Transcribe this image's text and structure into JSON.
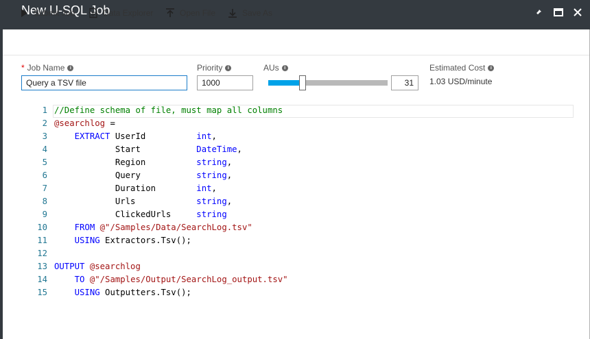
{
  "window": {
    "title": "New U-SQL Job"
  },
  "toolbar": {
    "submit_label": "Submit Job",
    "explorer_label": "Data Explorer",
    "open_label": "Open File",
    "saveas_label": "Save As"
  },
  "form": {
    "job_name_label": "Job Name",
    "required_mark": "*",
    "job_name_value": "Query a TSV file",
    "priority_label": "Priority",
    "priority_value": "1000",
    "aus_label": "AUs",
    "aus_value": "31",
    "aus_slider_fraction": 0.27,
    "cost_label": "Estimated Cost",
    "cost_value": "1.03 USD/minute",
    "info_glyph": "i"
  },
  "colors": {
    "titlebar": "#343a40",
    "accent": "#00a2e8",
    "keyword": "#0000ff",
    "string": "#a31515",
    "comment": "#008000",
    "line_number": "#237893"
  },
  "icons": [
    "pin-icon",
    "maximize-icon",
    "close-icon",
    "play-icon",
    "document-icon",
    "upload-icon",
    "download-icon",
    "info-icon"
  ],
  "editor": {
    "lines": [
      {
        "num": "1",
        "tokens": [
          {
            "t": "//Define schema of file, must map all columns",
            "c": "cm"
          }
        ]
      },
      {
        "num": "2",
        "tokens": [
          {
            "t": "@searchlog",
            "c": "str"
          },
          {
            "t": " =",
            "c": ""
          }
        ]
      },
      {
        "num": "3",
        "tokens": [
          {
            "t": "    ",
            "c": ""
          },
          {
            "t": "EXTRACT",
            "c": "kw"
          },
          {
            "t": " UserId          ",
            "c": ""
          },
          {
            "t": "int",
            "c": "kw"
          },
          {
            "t": ",",
            "c": ""
          }
        ]
      },
      {
        "num": "4",
        "tokens": [
          {
            "t": "            Start           ",
            "c": ""
          },
          {
            "t": "DateTime",
            "c": "kw"
          },
          {
            "t": ",",
            "c": ""
          }
        ]
      },
      {
        "num": "5",
        "tokens": [
          {
            "t": "            Region          ",
            "c": ""
          },
          {
            "t": "string",
            "c": "kw"
          },
          {
            "t": ",",
            "c": ""
          }
        ]
      },
      {
        "num": "6",
        "tokens": [
          {
            "t": "            Query           ",
            "c": ""
          },
          {
            "t": "string",
            "c": "kw"
          },
          {
            "t": ",",
            "c": ""
          }
        ]
      },
      {
        "num": "7",
        "tokens": [
          {
            "t": "            Duration        ",
            "c": ""
          },
          {
            "t": "int",
            "c": "kw"
          },
          {
            "t": ",",
            "c": ""
          }
        ]
      },
      {
        "num": "8",
        "tokens": [
          {
            "t": "            Urls            ",
            "c": ""
          },
          {
            "t": "string",
            "c": "kw"
          },
          {
            "t": ",",
            "c": ""
          }
        ]
      },
      {
        "num": "9",
        "tokens": [
          {
            "t": "            ClickedUrls     ",
            "c": ""
          },
          {
            "t": "string",
            "c": "kw"
          }
        ]
      },
      {
        "num": "10",
        "tokens": [
          {
            "t": "    ",
            "c": ""
          },
          {
            "t": "FROM",
            "c": "kw"
          },
          {
            "t": " ",
            "c": ""
          },
          {
            "t": "@\"/Samples/Data/SearchLog.tsv\"",
            "c": "str"
          }
        ]
      },
      {
        "num": "11",
        "tokens": [
          {
            "t": "    ",
            "c": ""
          },
          {
            "t": "USING",
            "c": "kw"
          },
          {
            "t": " Extractors.Tsv();",
            "c": ""
          }
        ]
      },
      {
        "num": "12",
        "tokens": []
      },
      {
        "num": "13",
        "tokens": [
          {
            "t": "OUTPUT",
            "c": "kw"
          },
          {
            "t": " ",
            "c": ""
          },
          {
            "t": "@searchlog",
            "c": "str"
          }
        ]
      },
      {
        "num": "14",
        "tokens": [
          {
            "t": "    ",
            "c": ""
          },
          {
            "t": "TO",
            "c": "kw"
          },
          {
            "t": " ",
            "c": ""
          },
          {
            "t": "@\"/Samples/Output/SearchLog_output.tsv\"",
            "c": "str"
          }
        ]
      },
      {
        "num": "15",
        "tokens": [
          {
            "t": "    ",
            "c": ""
          },
          {
            "t": "USING",
            "c": "kw"
          },
          {
            "t": " Outputters.Tsv();",
            "c": ""
          }
        ]
      }
    ]
  }
}
